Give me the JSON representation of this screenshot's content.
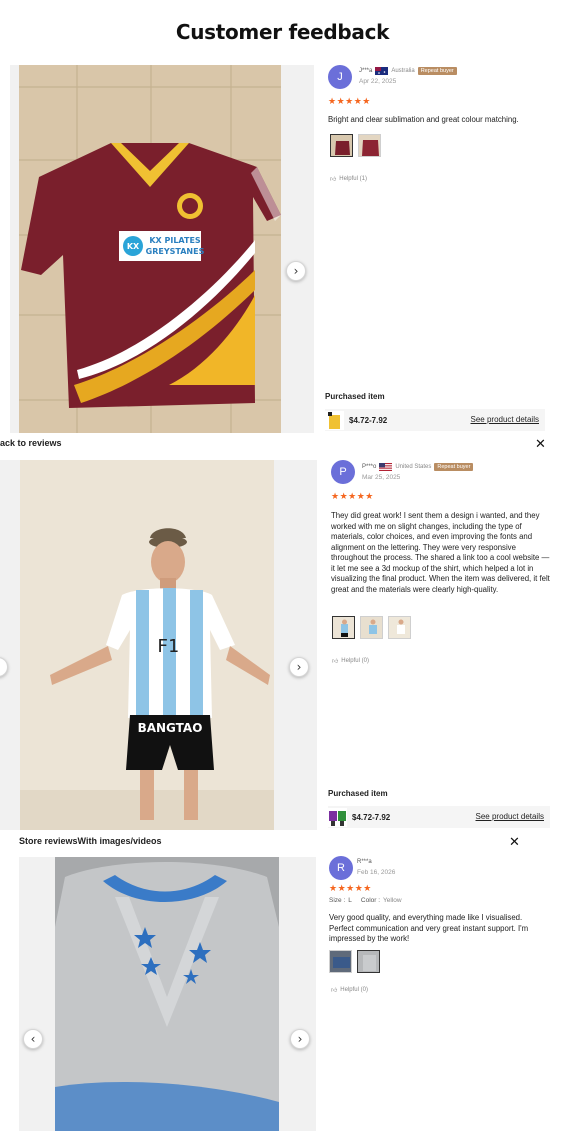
{
  "page_title": "Customer feedback",
  "reviews": [
    {
      "avatar_letter": "J",
      "name": "J***a",
      "country": "Australia",
      "badge": "Repeat buyer",
      "date": "Apr 22, 2025",
      "stars": "★★★★★",
      "text": "Bright and clear sublimation and great colour matching.",
      "helpful": "Helpful (1)",
      "purchased_label": "Purchased item",
      "price": "$4.72-7.92",
      "see_details": "See product details",
      "prev_icon": "chevron-left-icon",
      "next_icon": "chevron-right-icon"
    },
    {
      "avatar_letter": "P",
      "name": "P***o",
      "country": "United States",
      "badge": "Repeat buyer",
      "date": "Mar 25, 2025",
      "stars": "★★★★★",
      "text": "They did great work! I sent them a design i wanted, and they worked with me on slight changes, including the type of materials, color choices, and even improving the fonts and alignment on the lettering. They were very responsive throughout the process. The shared a link too a cool website —it let me see a 3d mockup of the shirt, which helped a lot in visualizing the final product. When the item was delivered, it felt great and the materials were clearly high-quality.",
      "helpful": "Helpful (0)",
      "purchased_label": "Purchased item",
      "price": "$4.72-7.92",
      "see_details": "See product details",
      "jersey_print": "F1",
      "shorts_print": "BANGTAO"
    },
    {
      "avatar_letter": "R",
      "name": "R***a",
      "date": "Feb 16, 2026",
      "stars": "★★★★★",
      "size_label": "Size :",
      "size_value": "L",
      "color_label": "Color :",
      "color_value": "Yellow",
      "text": "Very good quality, and everything made like I visualised. Perfect communication and very great instant support. I'm impressed by the work!",
      "helpful": "Helpful (0)"
    }
  ],
  "strips": {
    "back_text": "ack to reviews",
    "store_reviews": "Store reviews",
    "with_images": "With images/videos",
    "close": "✕"
  },
  "jersey1_sponsor_line1": "KX PILATES",
  "jersey1_sponsor_line2": "GREYSTANES",
  "jersey1_sponsor_logo": "KX",
  "colors": {
    "accent_star": "#f5661f",
    "avatar": "#6b6fd9",
    "badge": "#b98d62"
  }
}
